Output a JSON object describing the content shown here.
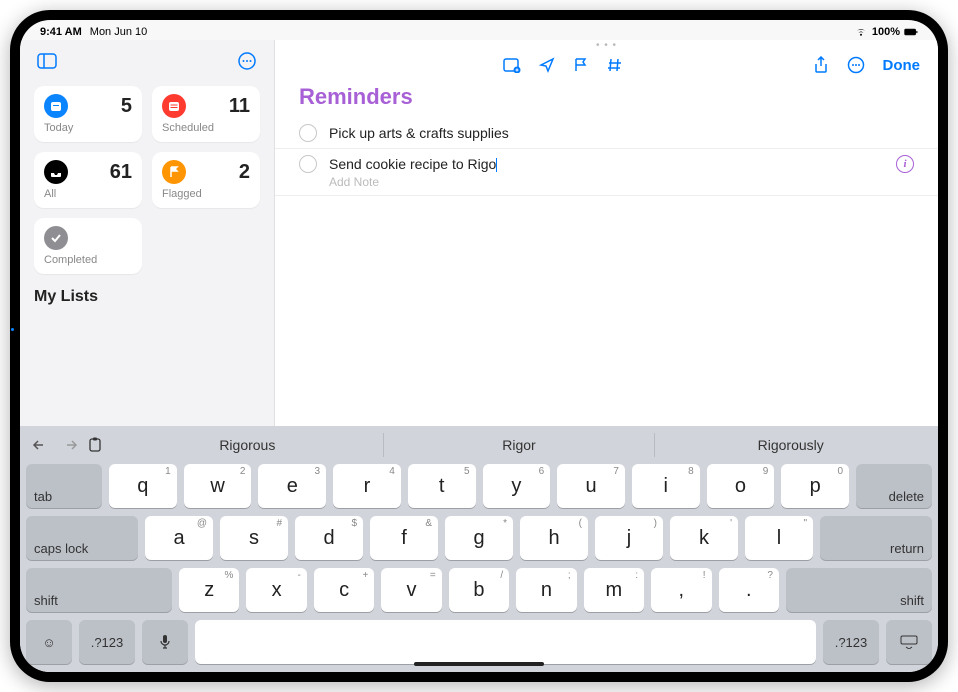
{
  "status": {
    "time": "9:41 AM",
    "date": "Mon Jun 10",
    "battery": "100%"
  },
  "sidebar": {
    "cards": [
      {
        "label": "Today",
        "count": "5",
        "color": "#0a84ff",
        "icon": "calendar"
      },
      {
        "label": "Scheduled",
        "count": "11",
        "color": "#ff3b30",
        "icon": "calendar"
      },
      {
        "label": "All",
        "count": "61",
        "color": "#000",
        "icon": "tray"
      },
      {
        "label": "Flagged",
        "count": "2",
        "color": "#ff9500",
        "icon": "flag"
      },
      {
        "label": "Completed",
        "count": "",
        "color": "#8e8e93",
        "icon": "check"
      }
    ],
    "mylists_label": "My Lists"
  },
  "content": {
    "title": "Reminders",
    "done_label": "Done",
    "reminders": [
      {
        "text": "Pick up arts & crafts supplies",
        "editing": false
      },
      {
        "text": "Send cookie recipe to Rigo",
        "editing": true
      }
    ],
    "add_note_placeholder": "Add Note"
  },
  "keyboard": {
    "suggestions": [
      "Rigorous",
      "Rigor",
      "Rigorously"
    ],
    "row1_hints": [
      "1",
      "2",
      "3",
      "4",
      "5",
      "6",
      "7",
      "8",
      "9",
      "0"
    ],
    "row1": [
      "q",
      "w",
      "e",
      "r",
      "t",
      "y",
      "u",
      "i",
      "o",
      "p"
    ],
    "row2_hints": [
      "@",
      "#",
      "$",
      "&",
      "*",
      "(",
      ")",
      "'",
      "\""
    ],
    "row2": [
      "a",
      "s",
      "d",
      "f",
      "g",
      "h",
      "j",
      "k",
      "l"
    ],
    "row3_hints": [
      "%",
      "-",
      "+",
      "=",
      "/",
      ";",
      ":",
      "!",
      "?"
    ],
    "row3": [
      "z",
      "x",
      "c",
      "v",
      "b",
      "n",
      "m",
      ",",
      "."
    ],
    "labels": {
      "tab": "tab",
      "delete": "delete",
      "caps": "caps lock",
      "return": "return",
      "shift": "shift",
      "numsym": ".?123"
    }
  }
}
